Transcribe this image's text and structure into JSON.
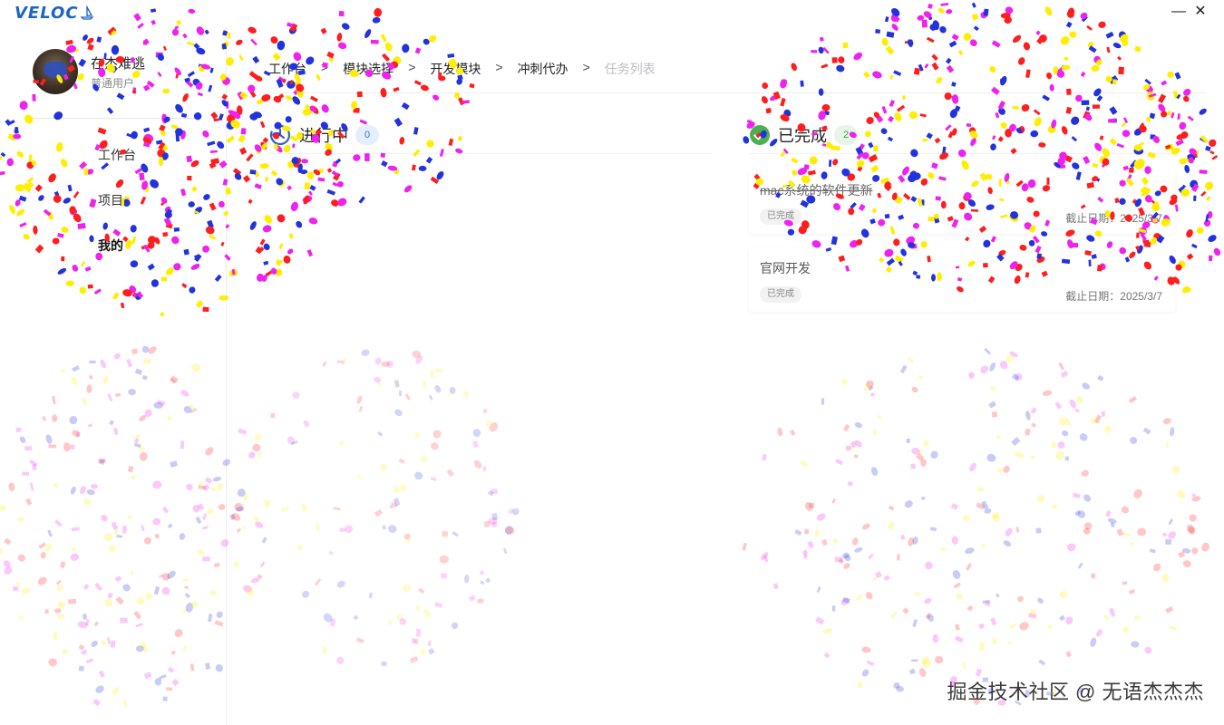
{
  "app": {
    "logo": "VELOC"
  },
  "window": {
    "minimize_glyph": "—",
    "close_glyph": "✕"
  },
  "user": {
    "name": "在杰难逃",
    "role": "普通用户"
  },
  "sidebar": {
    "items": [
      {
        "label": "工作台"
      },
      {
        "label": "项目"
      },
      {
        "label": "我的"
      }
    ]
  },
  "breadcrumb": {
    "items": [
      "工作台",
      "模块选择",
      "开发模块",
      "冲刺代办",
      "任务列表"
    ],
    "separator": ">"
  },
  "columns": {
    "in_progress": {
      "label": "进行中",
      "count": "0"
    },
    "done": {
      "label": "已完成",
      "count": "2"
    }
  },
  "tasks": [
    {
      "title": "mac系统的软件更新",
      "status": "已完成",
      "deadline": "截止日期：2025/3/7"
    },
    {
      "title": "官网开发",
      "status": "已完成",
      "deadline": "截止日期：2025/3/7"
    }
  ],
  "watermark": "掘金技术社区 @ 无语杰杰杰",
  "colors": {
    "accent": "#1e63c9",
    "done_green": "#4caf50",
    "confetti": [
      "#ff1e1e",
      "#ffee00",
      "#2233dd",
      "#ee22ee"
    ]
  }
}
